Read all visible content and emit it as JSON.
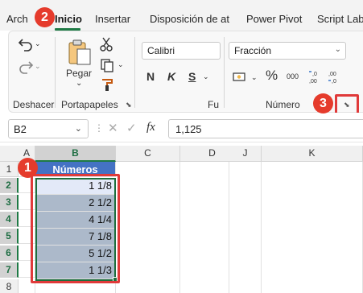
{
  "tabs": [
    "Arch",
    "Inicio",
    "Insertar",
    "Disposición de at",
    "Power Pivot",
    "Script Lab"
  ],
  "ribbon": {
    "groups": {
      "undo": "Deshacer",
      "clipboard": "Portapapeles",
      "font": "Fu",
      "number": "Número"
    },
    "paste_label": "Pegar",
    "font_name": "Calibri",
    "bold_label": "N",
    "italic_label": "K",
    "underline_label": "S",
    "number_format": "Fracción",
    "percent_label": "%",
    "thousands_label": "000"
  },
  "formula_bar": {
    "name_box": "B2",
    "fx_label": "fx",
    "value": "1,125"
  },
  "grid": {
    "columns": [
      "A",
      "B",
      "C",
      "D",
      "J",
      "K"
    ],
    "rows": [
      "1",
      "2",
      "3",
      "4",
      "5",
      "6",
      "7",
      "8"
    ],
    "header_cell": "Números",
    "values": [
      "1 1/8",
      "2 1/2",
      "4 1/4",
      "7 1/8",
      "5 1/2",
      "1 1/3"
    ]
  },
  "callouts": [
    "1",
    "2",
    "3"
  ],
  "colors": {
    "header_fill": "#4472c4",
    "data_fill": "#acb9ca",
    "selection": "#1e6e3d",
    "callout": "#e53b2c"
  }
}
